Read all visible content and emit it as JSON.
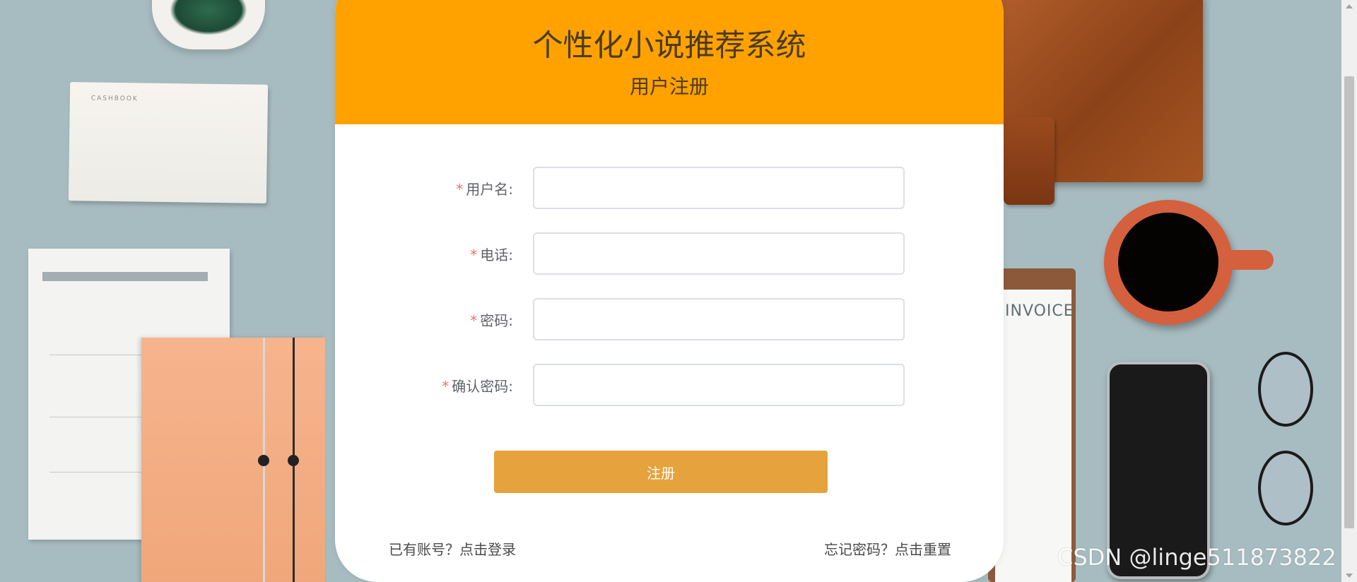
{
  "header": {
    "system_title": "个性化小说推荐系统",
    "page_subtitle": "用户注册"
  },
  "form": {
    "required_mark": "*",
    "fields": [
      {
        "label": "用户名:",
        "value": ""
      },
      {
        "label": "电话:",
        "value": ""
      },
      {
        "label": "密码:",
        "value": ""
      },
      {
        "label": "确认密码:",
        "value": ""
      }
    ],
    "submit_label": "注册"
  },
  "links": {
    "login": "已有账号？点击登录",
    "reset": "忘记密码？点击重置"
  },
  "background": {
    "cashbook_label": "CASHBOOK",
    "invoice_label": "INVOICE"
  },
  "watermark": "CSDN @linge511873822",
  "colors": {
    "header_bg": "#ffa200",
    "button_bg": "#e6a23c",
    "required": "#f56c6c"
  }
}
